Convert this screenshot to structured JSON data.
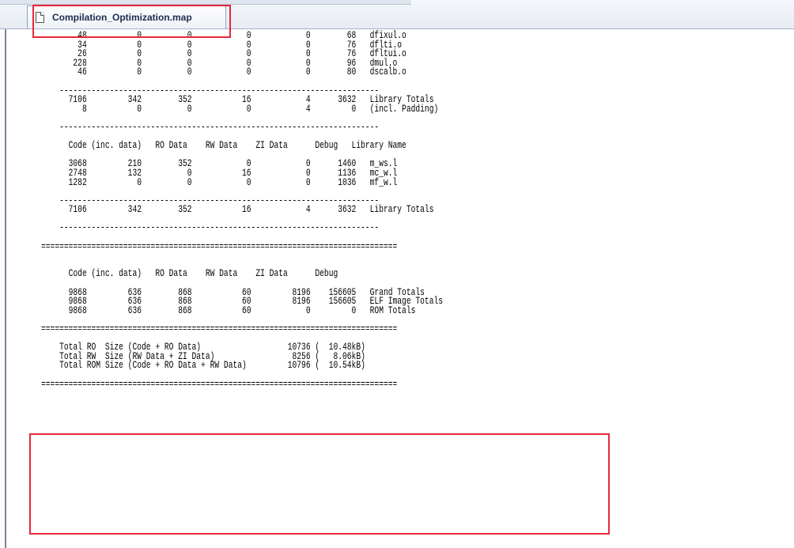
{
  "tab": {
    "title": "Compilation_Optimization.map",
    "icon": "document-icon"
  },
  "map_lines": [
    "        48           0          0            0            0        68   dfixul.o",
    "        34           0          0            0            0        76   dflti.o",
    "        26           0          0            0            0        76   dfltui.o",
    "       228           0          0            0            0        96   dmul.o",
    "        46           0          0            0            0        80   dscalb.o",
    "",
    "    ----------------------------------------------------------------------",
    "      7106         342        352           16            4      3632   Library Totals",
    "         8           0          0            0            4         0   (incl. Padding)",
    "",
    "    ----------------------------------------------------------------------",
    "",
    "      Code (inc. data)   RO Data    RW Data    ZI Data      Debug   Library Name",
    "",
    "      3068         210        352            0            0      1460   m_ws.l",
    "      2748         132          0           16            0      1136   mc_w.l",
    "      1282           0          0            0            0      1036   mf_w.l",
    "",
    "    ----------------------------------------------------------------------",
    "      7106         342        352           16            4      3632   Library Totals",
    "",
    "    ----------------------------------------------------------------------",
    "",
    "==============================================================================",
    "",
    "",
    "      Code (inc. data)   RO Data    RW Data    ZI Data      Debug",
    "",
    "      9868         636        868           60         8196    156605   Grand Totals",
    "      9868         636        868           60         8196    156605   ELF Image Totals",
    "      9868         636        868           60            0         0   ROM Totals",
    "",
    "==============================================================================",
    "",
    "    Total RO  Size (Code + RO Data)                   10736 (  10.48kB)",
    "    Total RW  Size (RW Data + ZI Data)                 8256 (   8.06kB)",
    "    Total ROM Size (Code + RO Data + RW Data)         10796 (  10.54kB)",
    "",
    "=============================================================================="
  ]
}
